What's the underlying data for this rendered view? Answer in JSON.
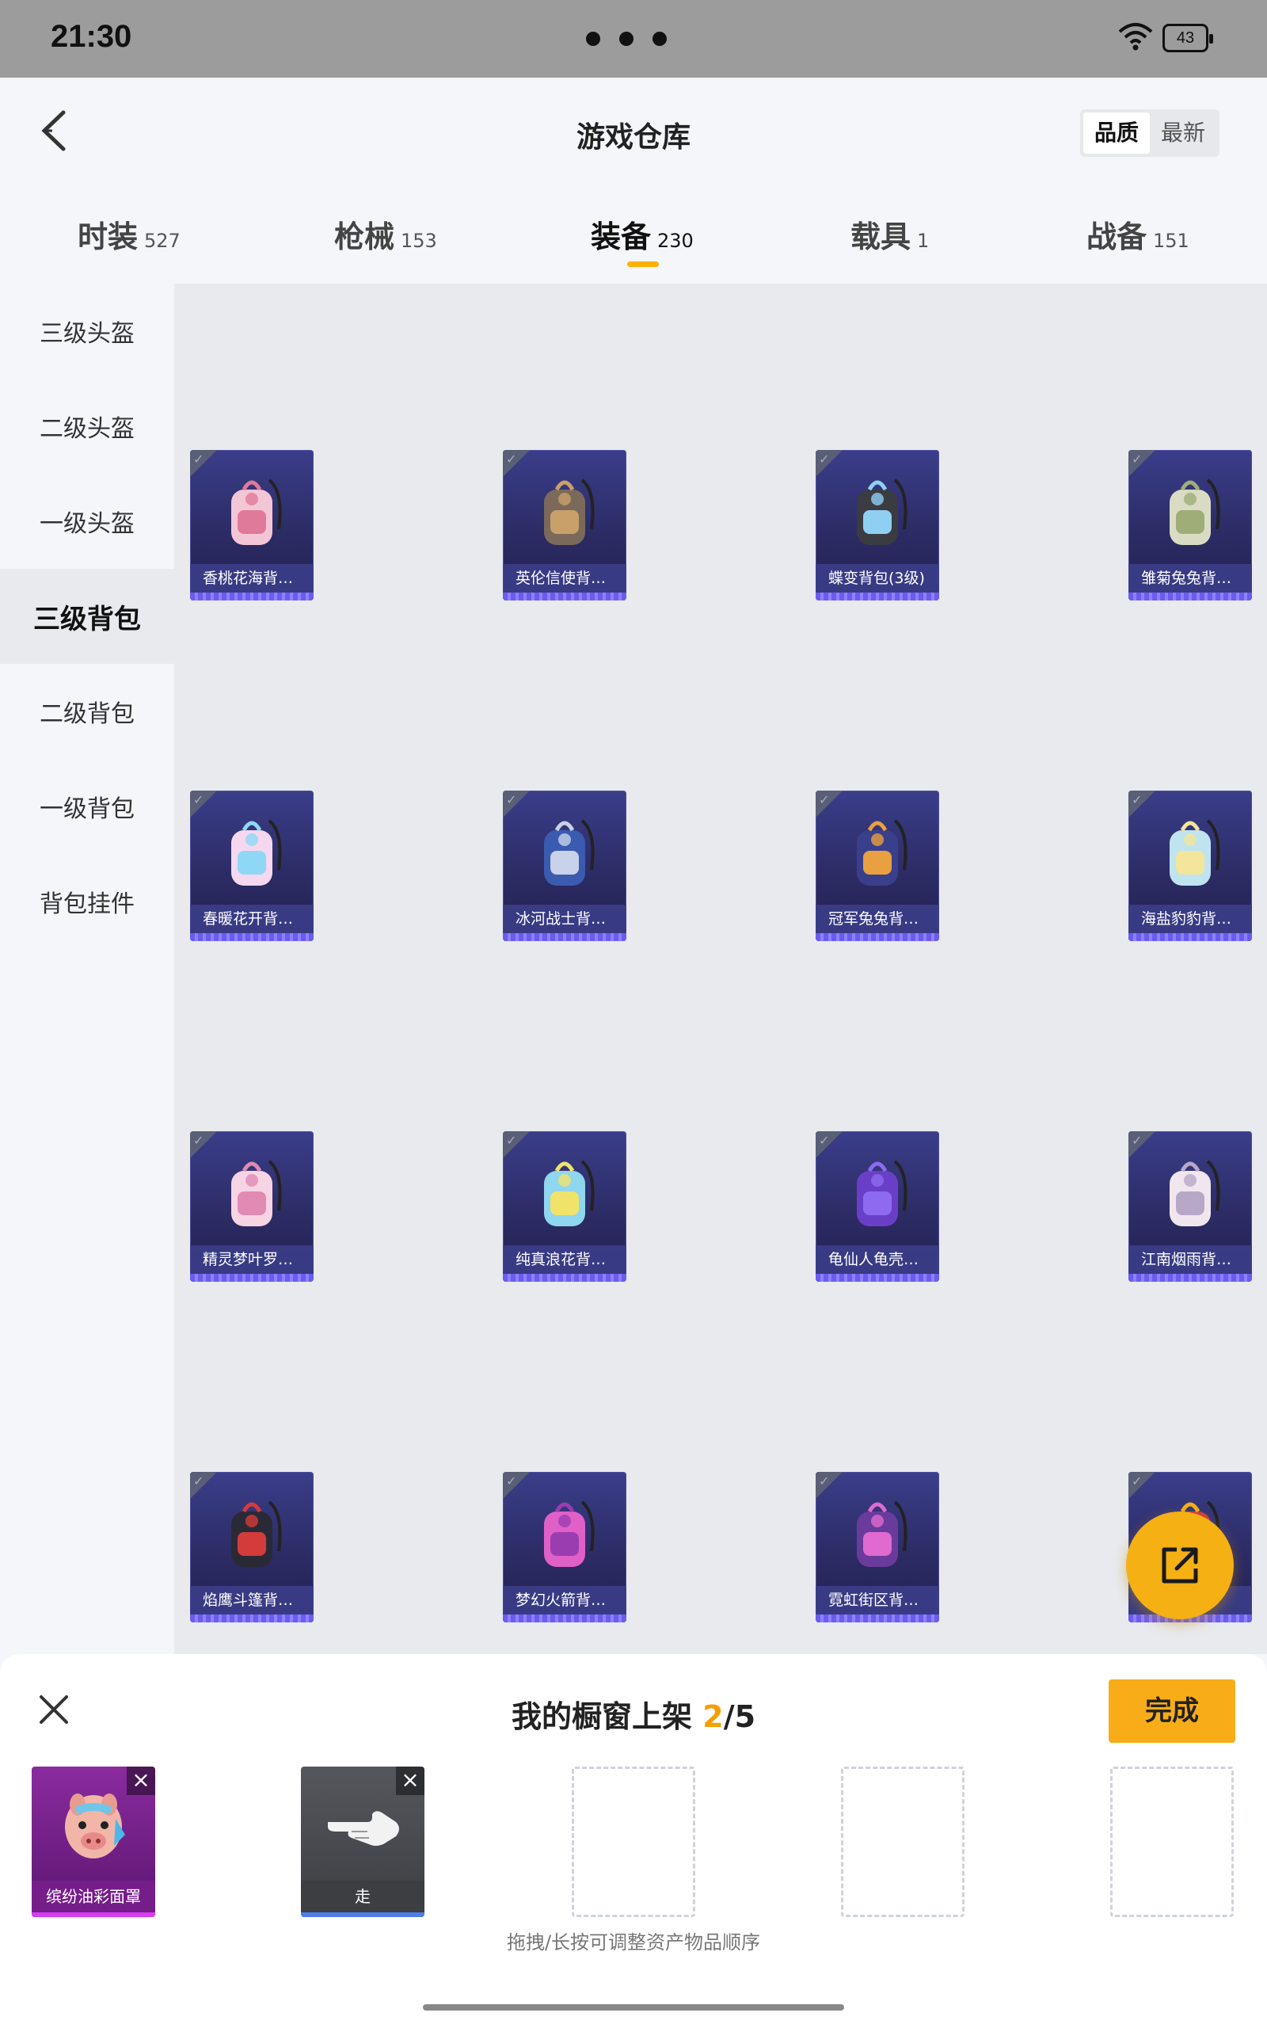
{
  "status": {
    "time": "21:30",
    "battery": "43"
  },
  "header": {
    "title": "游戏仓库",
    "sort_options": [
      "品质",
      "最新"
    ]
  },
  "tabs": [
    {
      "label": "时装",
      "count": "527"
    },
    {
      "label": "枪械",
      "count": "153"
    },
    {
      "label": "装备",
      "count": "230"
    },
    {
      "label": "载具",
      "count": "1"
    },
    {
      "label": "战备",
      "count": "151"
    }
  ],
  "sidebar": [
    "三级头盔",
    "二级头盔",
    "一级头盔",
    "三级背包",
    "二级背包",
    "一级背包",
    "背包挂件"
  ],
  "items": [
    "香桃花海背…",
    "英伦信使背…",
    "蝶变背包(3级)",
    "雏菊兔兔背…",
    "春暖花开背…",
    "冰河战士背…",
    "冠军兔兔背…",
    "海盐豹豹背…",
    "精灵梦叶罗…",
    "纯真浪花背…",
    "龟仙人龟壳…",
    "江南烟雨背…",
    "焰鹰斗篷背…",
    "梦幻火箭背…",
    "霓虹街区背…",
    ""
  ],
  "panel": {
    "title": "我的橱窗上架",
    "count": "2",
    "total": "/5",
    "done": "完成",
    "slots": [
      "缤纷油彩面罩",
      "走"
    ],
    "hint": "拖拽/长按可调整资产物品顺序"
  },
  "colors": {
    "accent": "#f5b014",
    "card_bg": "#2b2a62"
  }
}
